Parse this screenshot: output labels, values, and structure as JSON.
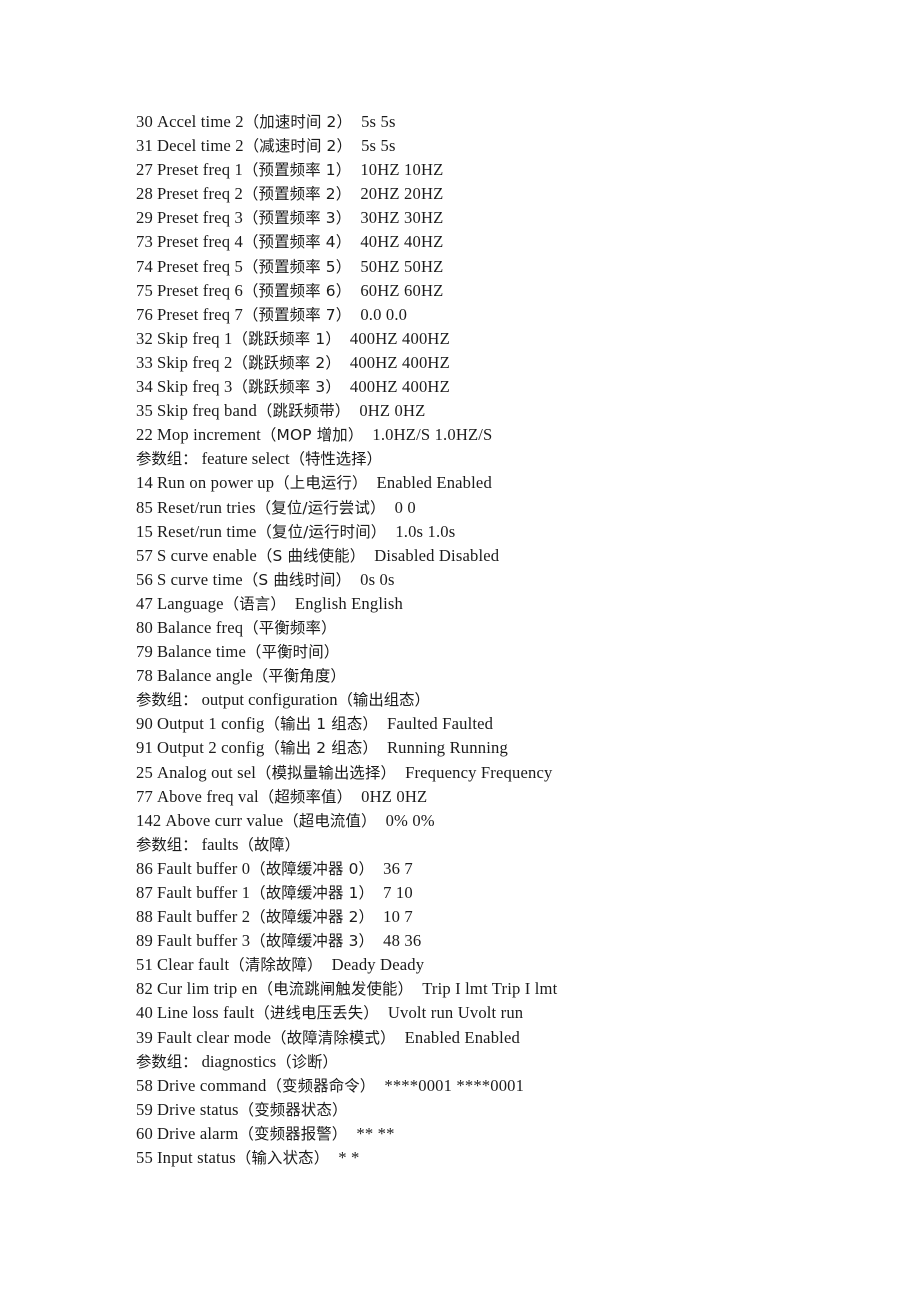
{
  "document": {
    "type": "parameter-list",
    "page_background": "#ffffff",
    "text_color": "#1b1b1b",
    "group_label_prefix": "参数组：",
    "lines": [
      {
        "kind": "param",
        "num": "30",
        "en": "Accel time 2",
        "cn": "（加速时间 2）",
        "val": "5s 5s"
      },
      {
        "kind": "param",
        "num": "31",
        "en": "Decel time 2",
        "cn": "（减速时间 2）",
        "val": "5s 5s"
      },
      {
        "kind": "param",
        "num": "27",
        "en": "Preset freq 1",
        "cn": "（预置频率 1）",
        "val": "10HZ 10HZ"
      },
      {
        "kind": "param",
        "num": "28",
        "en": "Preset freq 2",
        "cn": "（预置频率 2）",
        "val": "20HZ 20HZ"
      },
      {
        "kind": "param",
        "num": "29",
        "en": "Preset freq 3",
        "cn": "（预置频率 3）",
        "val": "30HZ 30HZ"
      },
      {
        "kind": "param",
        "num": "73",
        "en": "Preset freq 4",
        "cn": "（预置频率 4）",
        "val": "40HZ 40HZ"
      },
      {
        "kind": "param",
        "num": "74",
        "en": "Preset freq 5",
        "cn": "（预置频率 5）",
        "val": "50HZ 50HZ"
      },
      {
        "kind": "param",
        "num": "75",
        "en": "Preset freq 6",
        "cn": "（预置频率 6）",
        "val": "60HZ 60HZ"
      },
      {
        "kind": "param",
        "num": "76",
        "en": "Preset freq 7",
        "cn": "（预置频率 7）",
        "val": "0.0 0.0"
      },
      {
        "kind": "param",
        "num": "32",
        "en": "Skip freq 1",
        "cn": "（跳跃频率 1）",
        "val": "400HZ 400HZ"
      },
      {
        "kind": "param",
        "num": "33",
        "en": "Skip freq 2",
        "cn": "（跳跃频率 2）",
        "val": "400HZ 400HZ"
      },
      {
        "kind": "param",
        "num": "34",
        "en": "Skip freq 3",
        "cn": "（跳跃频率 3）",
        "val": "400HZ 400HZ"
      },
      {
        "kind": "param",
        "num": "35",
        "en": "Skip freq band",
        "cn": "（跳跃频带）",
        "val": "0HZ 0HZ"
      },
      {
        "kind": "param",
        "num": "22",
        "en": "Mop increment",
        "cn": "（MOP 增加）",
        "val": "1.0HZ/S 1.0HZ/S"
      },
      {
        "kind": "group",
        "en": "feature select",
        "cn": "（特性选择）"
      },
      {
        "kind": "param",
        "num": "14",
        "en": "Run on power up",
        "cn": "（上电运行）",
        "val": "Enabled Enabled"
      },
      {
        "kind": "param",
        "num": "85",
        "en": "Reset/run tries",
        "cn": "（复位/运行尝试）",
        "val": "0 0"
      },
      {
        "kind": "param",
        "num": "15",
        "en": "Reset/run time",
        "cn": "（复位/运行时间）",
        "val": "1.0s 1.0s"
      },
      {
        "kind": "param",
        "num": "57",
        "en": "S curve enable",
        "cn": "（S 曲线使能）",
        "val": "Disabled Disabled"
      },
      {
        "kind": "param",
        "num": "56",
        "en": "S curve time",
        "cn": "（S 曲线时间）",
        "val": "0s 0s"
      },
      {
        "kind": "param",
        "num": "47",
        "en": "Language",
        "cn": "（语言）",
        "val": "English English"
      },
      {
        "kind": "param",
        "num": "80",
        "en": "Balance freq",
        "cn": "（平衡频率）",
        "val": ""
      },
      {
        "kind": "param",
        "num": "79",
        "en": "Balance time",
        "cn": "（平衡时间）",
        "val": ""
      },
      {
        "kind": "param",
        "num": "78",
        "en": "Balance angle",
        "cn": "（平衡角度）",
        "val": ""
      },
      {
        "kind": "group",
        "en": "output configuration",
        "cn": "（输出组态）"
      },
      {
        "kind": "param",
        "num": "90",
        "en": "Output 1 config",
        "cn": "（输出 1 组态）",
        "val": "Faulted Faulted"
      },
      {
        "kind": "param",
        "num": "91",
        "en": "Output 2 config",
        "cn": "（输出 2 组态）",
        "val": "Running Running"
      },
      {
        "kind": "param",
        "num": "25",
        "en": "Analog out sel",
        "cn": "（模拟量输出选择）",
        "val": "Frequency Frequency"
      },
      {
        "kind": "param",
        "num": "77",
        "en": "Above freq val",
        "cn": "（超频率值）",
        "val": "0HZ 0HZ"
      },
      {
        "kind": "param",
        "num": "142",
        "en": "Above curr value",
        "cn": "（超电流值）",
        "val": "0% 0%"
      },
      {
        "kind": "group",
        "en": "faults",
        "cn": "（故障）"
      },
      {
        "kind": "param",
        "num": "86",
        "en": "Fault buffer 0",
        "cn": "（故障缓冲器 0）",
        "val": "36 7"
      },
      {
        "kind": "param",
        "num": "87",
        "en": "Fault buffer 1",
        "cn": "（故障缓冲器 1）",
        "val": "7 10"
      },
      {
        "kind": "param",
        "num": "88",
        "en": "Fault buffer 2",
        "cn": "（故障缓冲器 2）",
        "val": "10 7"
      },
      {
        "kind": "param",
        "num": "89",
        "en": "Fault buffer 3",
        "cn": "（故障缓冲器 3）",
        "val": "48 36"
      },
      {
        "kind": "param",
        "num": "51",
        "en": "Clear fault",
        "cn": "（清除故障）",
        "val": "Deady Deady"
      },
      {
        "kind": "param",
        "num": "82",
        "en": "Cur lim trip en",
        "cn": "（电流跳闸触发使能）",
        "val": "Trip I lmt Trip I lmt"
      },
      {
        "kind": "param",
        "num": "40",
        "en": "Line loss fault",
        "cn": "（进线电压丢失）",
        "val": "Uvolt run Uvolt run"
      },
      {
        "kind": "param",
        "num": "39",
        "en": "Fault clear mode",
        "cn": "（故障清除模式）",
        "val": "Enabled Enabled"
      },
      {
        "kind": "group",
        "en": "diagnostics",
        "cn": "（诊断）"
      },
      {
        "kind": "param",
        "num": "58",
        "en": "Drive command",
        "cn": "（变频器命令）",
        "val": "****0001 ****0001"
      },
      {
        "kind": "param",
        "num": "59",
        "en": "Drive status",
        "cn": "（变频器状态）",
        "val": ""
      },
      {
        "kind": "param",
        "num": "60",
        "en": "Drive alarm",
        "cn": "（变频器报警）",
        "val": "** **"
      },
      {
        "kind": "param",
        "num": "55",
        "en": "Input status",
        "cn": "（输入状态）",
        "val": "* *"
      }
    ]
  }
}
